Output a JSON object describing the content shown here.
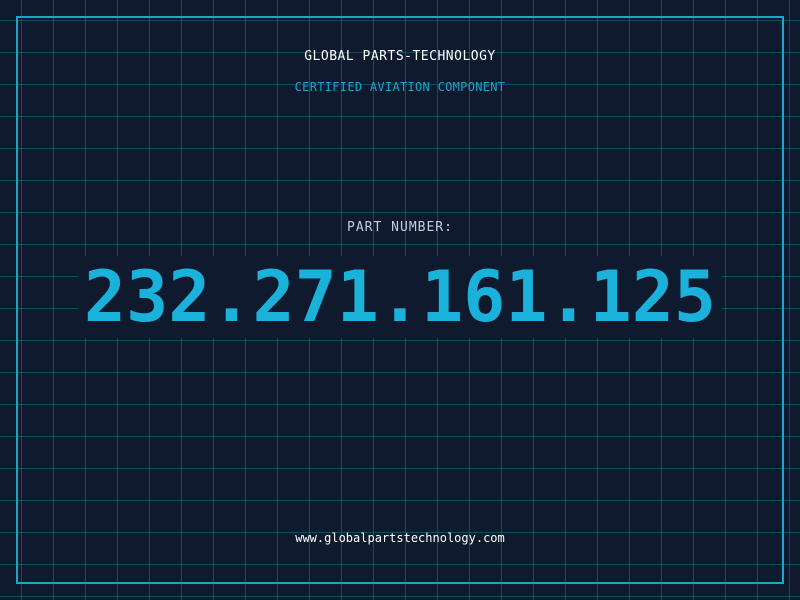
{
  "header": {
    "brand": "GLOBAL PARTS-TECHNOLOGY",
    "tagline": "CERTIFIED AVIATION COMPONENT"
  },
  "part": {
    "label": "PART NUMBER:",
    "number": "232.271.161.125"
  },
  "footer": {
    "url": "www.globalpartstechnology.com"
  },
  "colors": {
    "background": "#101a2e",
    "accent": "#1ab2da",
    "frame": "#1aa6c8",
    "text": "#ffffff"
  }
}
